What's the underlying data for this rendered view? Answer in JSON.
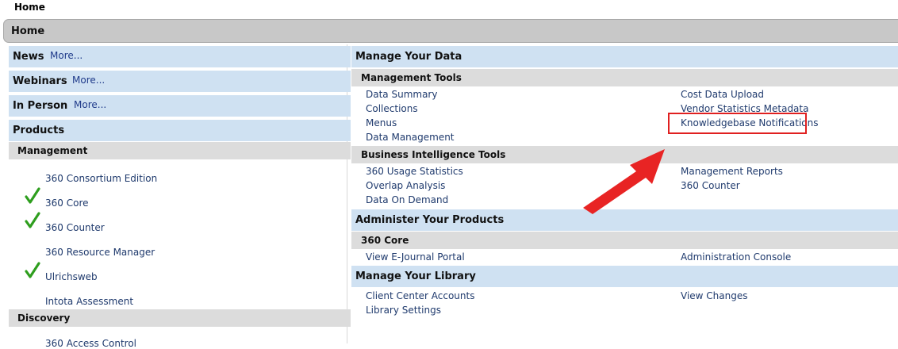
{
  "breadcrumb": "Home",
  "home_bar": "Home",
  "left": {
    "news": {
      "title": "News",
      "more": "More..."
    },
    "webinars": {
      "title": "Webinars",
      "more": "More..."
    },
    "in_person": {
      "title": "In Person",
      "more": "More..."
    },
    "products": {
      "title": "Products"
    },
    "management": {
      "title": "Management",
      "items": [
        {
          "label": "360 Consortium Edition",
          "checked": false
        },
        {
          "label": "360 Core",
          "checked": true
        },
        {
          "label": "360 Counter",
          "checked": true
        },
        {
          "label": "360 Resource Manager",
          "checked": false
        },
        {
          "label": "Ulrichsweb",
          "checked": true
        },
        {
          "label": "Intota Assessment",
          "checked": false
        }
      ]
    },
    "discovery": {
      "title": "Discovery",
      "partial_item": "360 Access Control"
    }
  },
  "right": {
    "manage_data": {
      "title": "Manage Your Data",
      "management_tools": {
        "title": "Management Tools",
        "left_links": [
          "Data Summary",
          "Collections",
          "Menus",
          "Data Management"
        ],
        "right_links": [
          "Cost Data Upload",
          "Vendor Statistics Metadata",
          "Knowledgebase Notifications"
        ]
      },
      "bi_tools": {
        "title": "Business Intelligence Tools",
        "left_links": [
          "360 Usage Statistics",
          "Overlap Analysis",
          "Data On Demand"
        ],
        "right_links": [
          "Management Reports",
          "360 Counter"
        ]
      }
    },
    "administer": {
      "title": "Administer Your Products",
      "core": {
        "title": "360 Core",
        "left_links": [
          "View E-Journal Portal"
        ],
        "right_links": [
          "Administration Console"
        ]
      }
    },
    "library": {
      "title": "Manage Your Library",
      "left_links": [
        "Client Center Accounts",
        "Library Settings"
      ],
      "right_links": [
        "View Changes"
      ]
    }
  },
  "colors": {
    "accent_highlight": "#e02020",
    "check": "#2e9e1e",
    "header_bg": "#cfe1f2",
    "subheader_bg": "#dcdcdc"
  }
}
